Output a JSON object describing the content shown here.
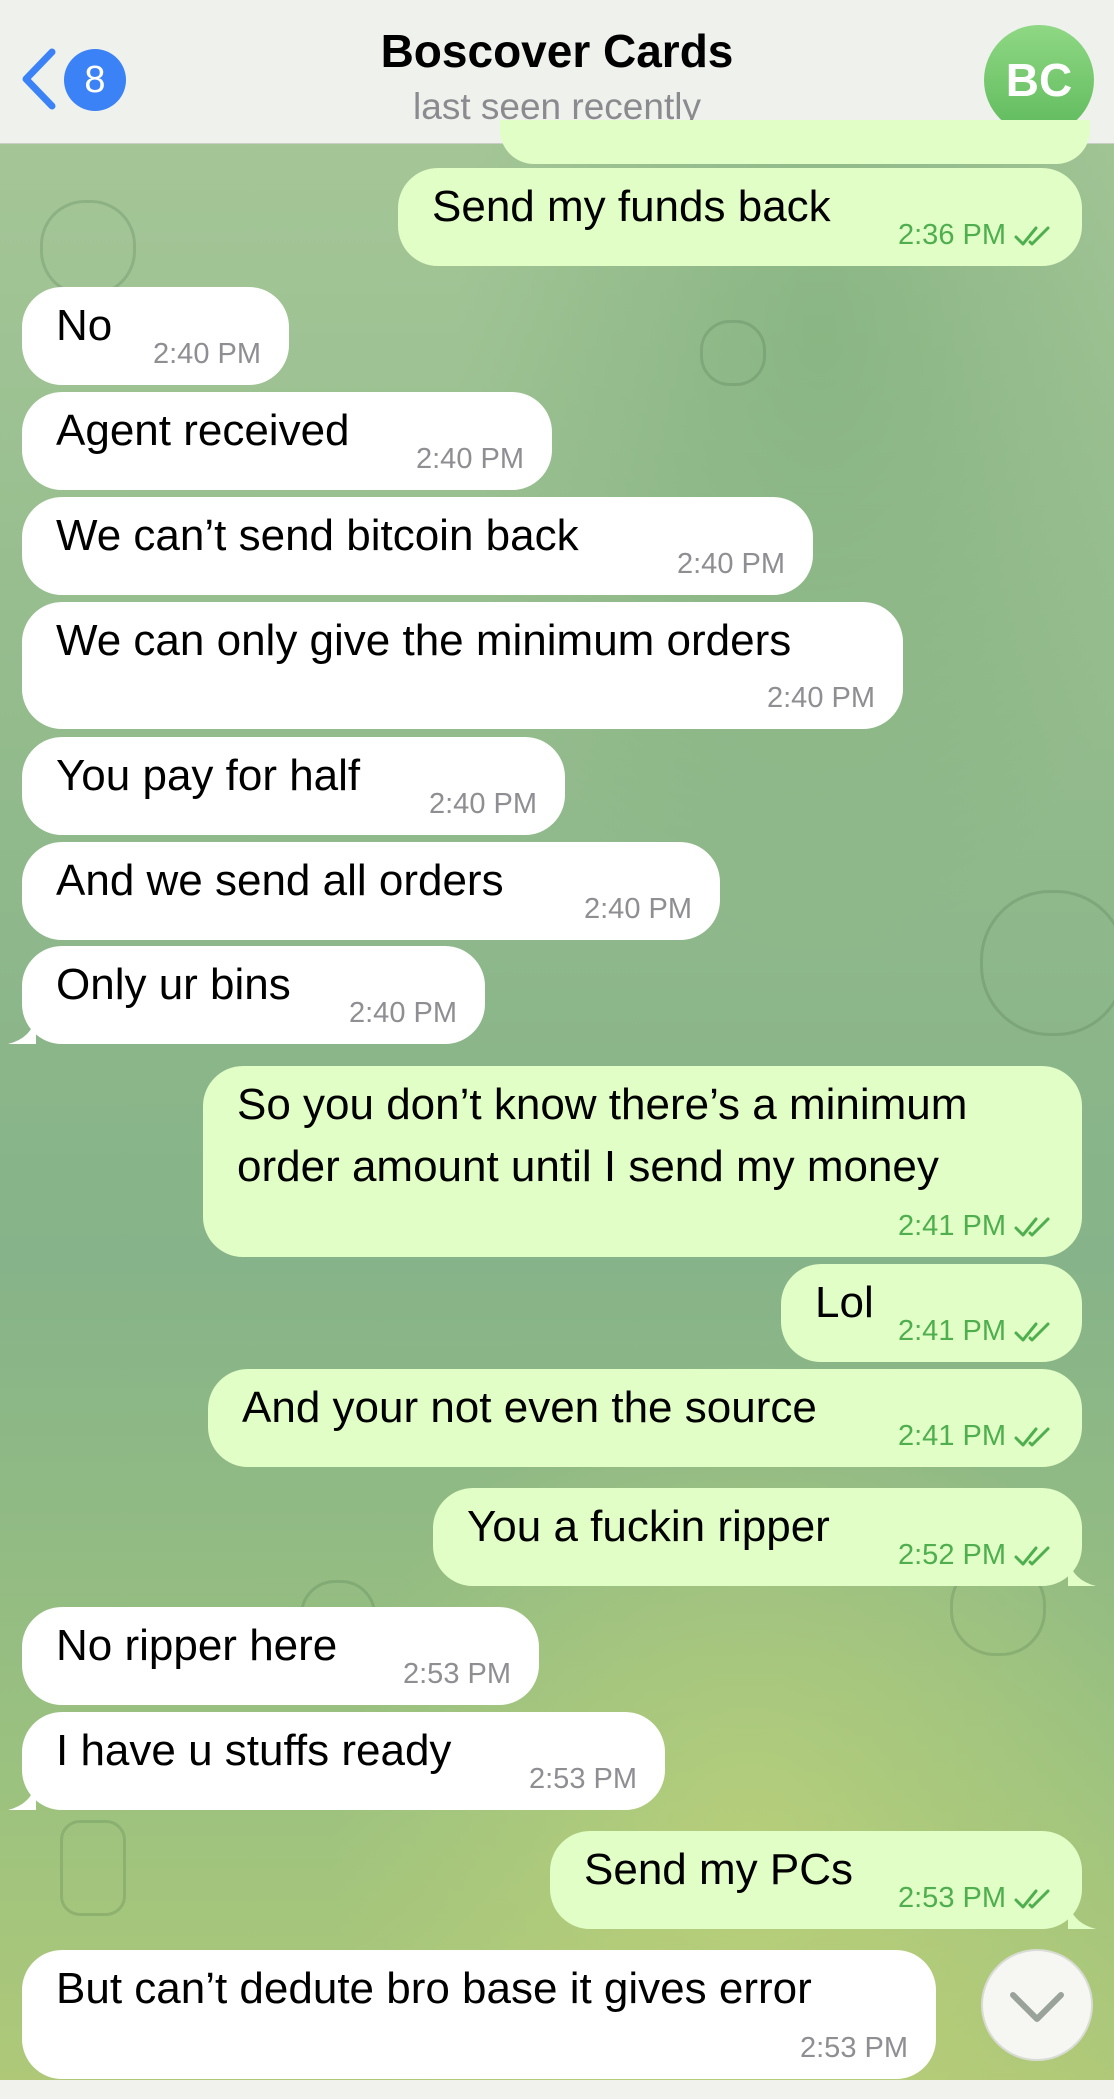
{
  "header": {
    "back_count": "8",
    "title": "Boscover Cards",
    "status": "last seen recently",
    "avatar_initials": "BC"
  },
  "messages": [
    {
      "dir": "out",
      "text": "Send my funds back",
      "time": "2:36 PM",
      "read": true
    },
    {
      "dir": "in",
      "text": "No",
      "time": "2:40 PM"
    },
    {
      "dir": "in",
      "text": "Agent received",
      "time": "2:40 PM"
    },
    {
      "dir": "in",
      "text": "We can’t send bitcoin back",
      "time": "2:40 PM"
    },
    {
      "dir": "in",
      "text": "We can only give the minimum orders",
      "time": "2:40 PM"
    },
    {
      "dir": "in",
      "text": "You pay for half",
      "time": "2:40 PM"
    },
    {
      "dir": "in",
      "text": "And we send all orders",
      "time": "2:40 PM"
    },
    {
      "dir": "in",
      "text": "Only ur bins",
      "time": "2:40 PM"
    },
    {
      "dir": "out",
      "text": "So you don’t know there’s a minimum order amount until I send my money",
      "time": "2:41 PM",
      "read": true
    },
    {
      "dir": "out",
      "text": "Lol",
      "time": "2:41 PM",
      "read": true
    },
    {
      "dir": "out",
      "text": "And your not even the source",
      "time": "2:41 PM",
      "read": true
    },
    {
      "dir": "out",
      "text": "You a fuckin ripper",
      "time": "2:52 PM",
      "read": true
    },
    {
      "dir": "in",
      "text": "No ripper here",
      "time": "2:53 PM"
    },
    {
      "dir": "in",
      "text": "I have u stuffs ready",
      "time": "2:53 PM"
    },
    {
      "dir": "out",
      "text": "Send my PCs",
      "time": "2:53 PM",
      "read": true
    },
    {
      "dir": "in",
      "text": "But can’t dedute bro base it gives error",
      "time": "2:53 PM"
    }
  ],
  "colors": {
    "incoming_bubble": "#ffffff",
    "outgoing_bubble": "#e1fec6",
    "accent": "#3b82f6",
    "read_tick": "#4fae4e"
  },
  "icons": {
    "back": "chevron-left-icon",
    "read": "double-check-icon",
    "scroll": "chevron-down-icon"
  }
}
